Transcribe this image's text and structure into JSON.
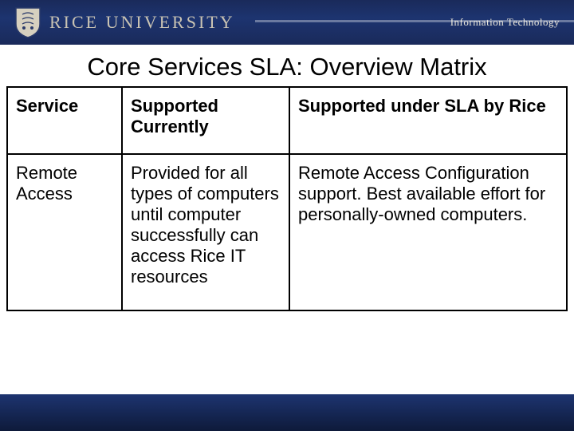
{
  "header": {
    "brand": "RICE UNIVERSITY",
    "department": "Information Technology"
  },
  "title": "Core Services SLA: Overview Matrix",
  "matrix": {
    "columns": [
      "Service",
      "Supported Currently",
      "Supported under SLA by Rice"
    ],
    "rows": [
      {
        "service": "Remote Access",
        "supported_currently": "Provided for all types of computers until computer successfully can access Rice IT resources",
        "supported_sla": "Remote Access Configuration support. Best available effort for personally-owned computers."
      }
    ]
  }
}
